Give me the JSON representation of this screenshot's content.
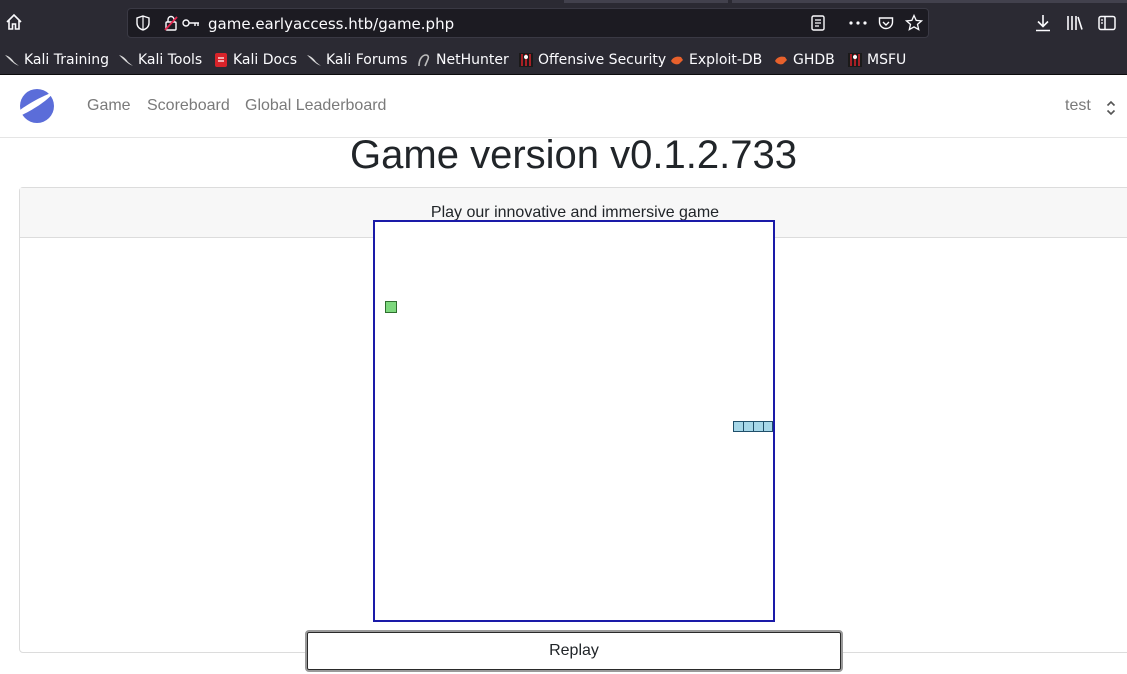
{
  "browser": {
    "url": "game.earlyaccess.htb/game.php",
    "bookmarks": [
      {
        "label": "Kali Training",
        "icon": "kali-dragon-icon"
      },
      {
        "label": "Kali Tools",
        "icon": "kali-dragon-icon"
      },
      {
        "label": "Kali Docs",
        "icon": "kali-docs-icon"
      },
      {
        "label": "Kali Forums",
        "icon": "kali-dragon-icon"
      },
      {
        "label": "NetHunter",
        "icon": "nethunter-icon"
      },
      {
        "label": "Offensive Security",
        "icon": "offsec-icon"
      },
      {
        "label": "Exploit-DB",
        "icon": "exploitdb-icon"
      },
      {
        "label": "GHDB",
        "icon": "exploitdb-icon"
      },
      {
        "label": "MSFU",
        "icon": "offsec-icon"
      }
    ]
  },
  "nav": {
    "links": [
      "Game",
      "Scoreboard",
      "Global Leaderboard"
    ],
    "user": "test"
  },
  "page": {
    "title": "Game version v0.1.2.733",
    "card_header": "Play our innovative and immersive game",
    "replay_label": "Replay"
  },
  "colors": {
    "chrome_bg": "#2b2a33",
    "canvas_border": "#1a1aa8",
    "food": "#7dd87d",
    "snake": "#a6d7e8"
  }
}
